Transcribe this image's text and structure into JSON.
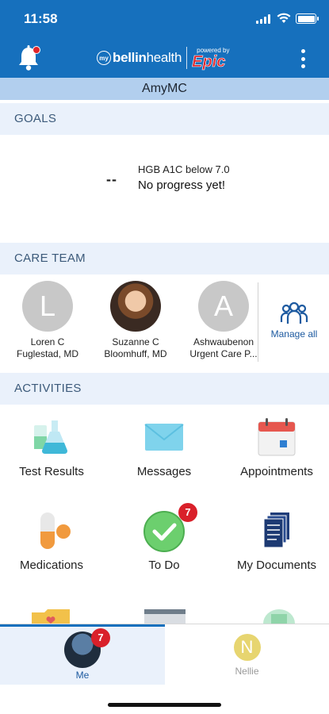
{
  "status_bar": {
    "time": "11:58"
  },
  "header": {
    "brand_my": "my",
    "brand_bellin": "bellin",
    "brand_health": "health",
    "brand_powered": "powered by",
    "brand_epic": "Epic",
    "user_name": "AmyMC"
  },
  "goals": {
    "heading": "GOALS",
    "value": "--",
    "title": "HGB A1C below 7.0",
    "progress": "No progress yet!"
  },
  "care_team": {
    "heading": "CARE TEAM",
    "members": [
      {
        "initial": "L",
        "line1": "Loren C",
        "line2": "Fuglestad, MD"
      },
      {
        "initial": "",
        "line1": "Suzanne C",
        "line2": "Bloomhuff, MD"
      },
      {
        "initial": "A",
        "line1": "Ashwaubenon",
        "line2": "Urgent Care P..."
      }
    ],
    "manage_label": "Manage all"
  },
  "activities": {
    "heading": "ACTIVITIES",
    "items": [
      {
        "label": "Test Results"
      },
      {
        "label": "Messages"
      },
      {
        "label": "Appointments"
      },
      {
        "label": "Medications"
      },
      {
        "label": "To Do",
        "badge": "7"
      },
      {
        "label": "My Documents"
      }
    ]
  },
  "bottom_nav": {
    "me_label": "Me",
    "me_badge": "7",
    "nellie_initial": "N",
    "nellie_label": "Nellie"
  },
  "colors": {
    "header": "#1670bd",
    "user_bar": "#b2cfee",
    "section_bg": "#eaf1fb",
    "badge": "#d9202a"
  }
}
